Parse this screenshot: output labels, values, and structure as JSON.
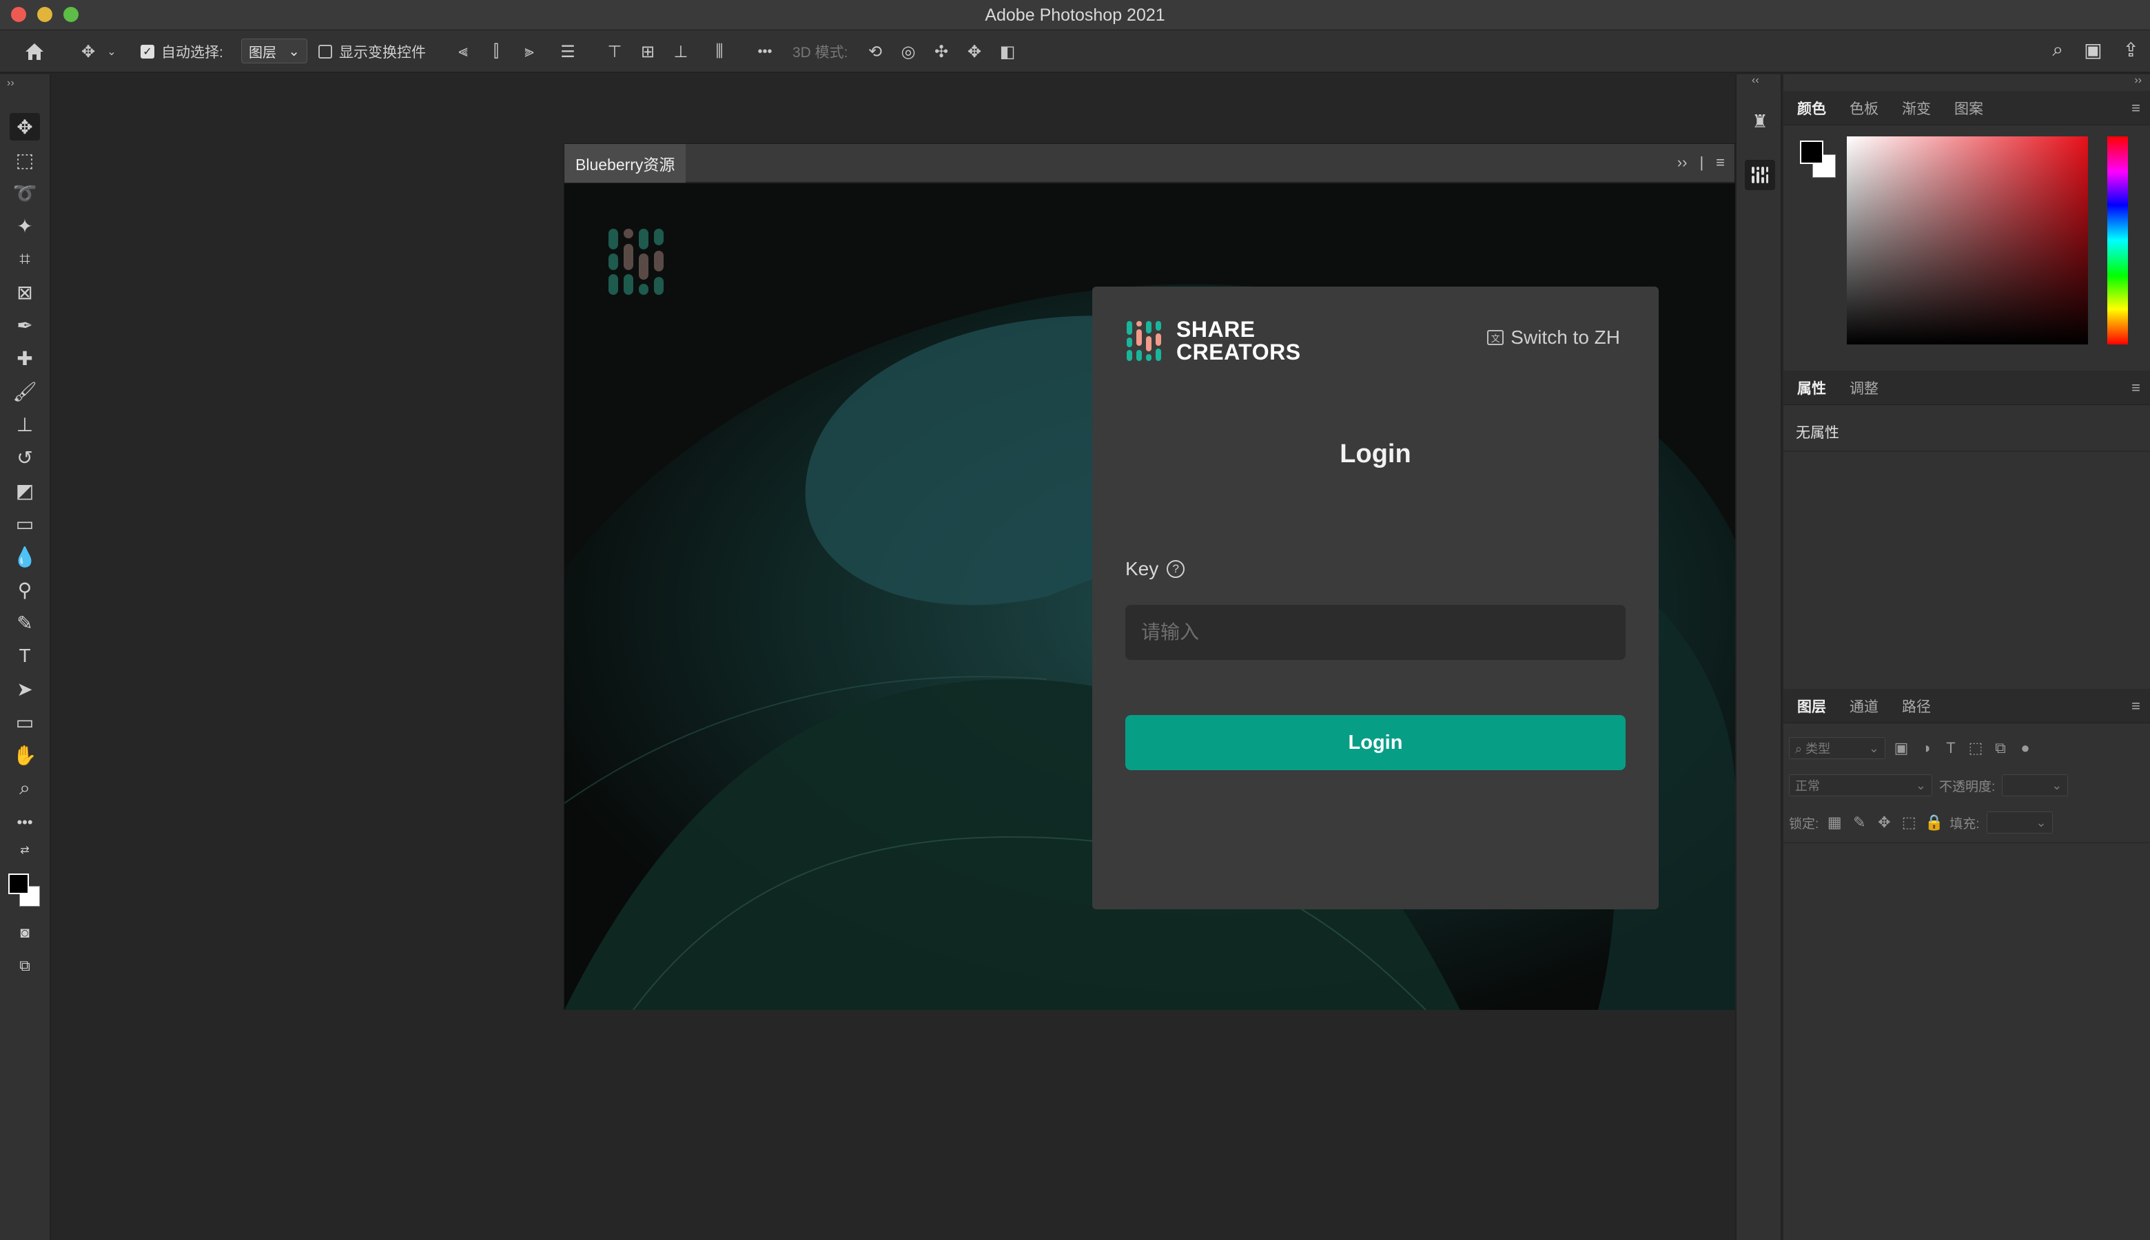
{
  "window": {
    "title": "Adobe Photoshop 2021"
  },
  "options_bar": {
    "auto_select_label": "自动选择:",
    "auto_select_value": "图层",
    "show_transform_label": "显示变换控件",
    "mode_3d_label": "3D 模式:",
    "more_label": "•••"
  },
  "plugin": {
    "tab_title": "Blueberry资源",
    "brand_line1": "SHARE",
    "brand_line2": "CREATORS",
    "switch_lang": "Switch to ZH",
    "title": "Login",
    "key_label": "Key",
    "key_placeholder": "请输入",
    "login_button": "Login"
  },
  "panels": {
    "color_tabs": [
      "颜色",
      "色板",
      "渐变",
      "图案"
    ],
    "props_tabs": [
      "属性",
      "调整"
    ],
    "props_empty": "无属性",
    "layer_tabs": [
      "图层",
      "通道",
      "路径"
    ],
    "layer_filter_placeholder": "类型",
    "blend_mode": "正常",
    "opacity_label": "不透明度:",
    "lock_label": "锁定:",
    "fill_label": "填充:"
  },
  "colors": {
    "accent_teal": "#079e86",
    "hue_red": "#e8101a"
  }
}
